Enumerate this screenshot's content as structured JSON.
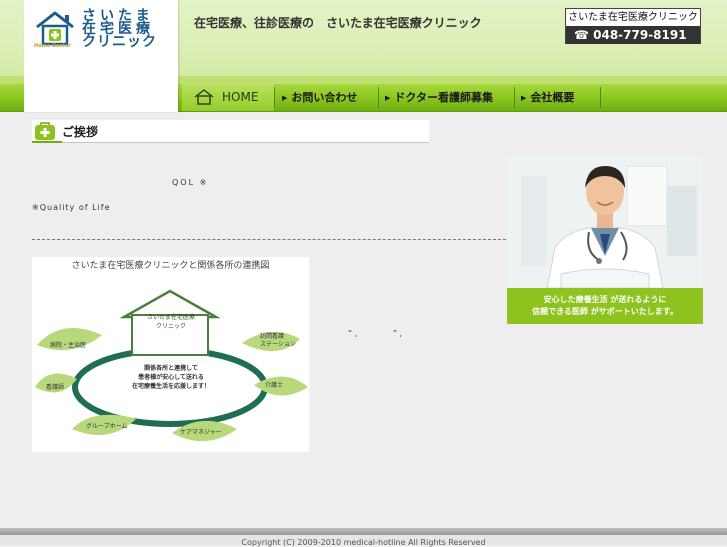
{
  "header": {
    "logo": {
      "line1": "さいたま",
      "line2": "在宅医療",
      "line3": "クリニック",
      "sub": "Home Doctor"
    },
    "tagline": "在宅医療、往診医療の　さいたま在宅医療クリニック",
    "phone_box": {
      "clinic_name": "さいたま在宅医療クリニック",
      "phone": "048-779-8191",
      "phone_icon": "phone-icon"
    }
  },
  "nav": {
    "items": [
      {
        "label": "HOME",
        "icon": "home-icon"
      },
      {
        "label": "お問い合わせ"
      },
      {
        "label": "ドクター看護師募集"
      },
      {
        "label": "会社概要"
      }
    ]
  },
  "main": {
    "section_title": "ご挨拶",
    "section_icon": "medical-bag-icon",
    "qol_text": "QOL ※",
    "qol_note": "※Quality of Life",
    "quote_marks": "“ ,              ” , ",
    "doctor_caption": {
      "line1": "安心した療養生活 が送れるように",
      "line2": "信頼できる医師 がサポートいたします。"
    },
    "diagram": {
      "title": "さいたま在宅医療クリニックと関係各所の連携図",
      "center_line1": "さいたま在宅医療",
      "center_line2": "クリニック",
      "core_line1": "関係各所と連携して",
      "core_line2": "患者様が安心して送れる",
      "core_line3": "在宅療養生活を応援します！",
      "leaves": [
        "病院・主治医",
        "訪問看護\nステーション",
        "看護師",
        "介護士",
        "グループホーム",
        "ケアマネジャー"
      ]
    }
  },
  "footer": {
    "copyright": "Copyright (C) 2009-2010 medical-hotline All Rights Reserved"
  },
  "colors": {
    "brand_green": "#8dc21f",
    "nav_green": "#8cc820",
    "logo_blue": "#1e5a8c"
  }
}
